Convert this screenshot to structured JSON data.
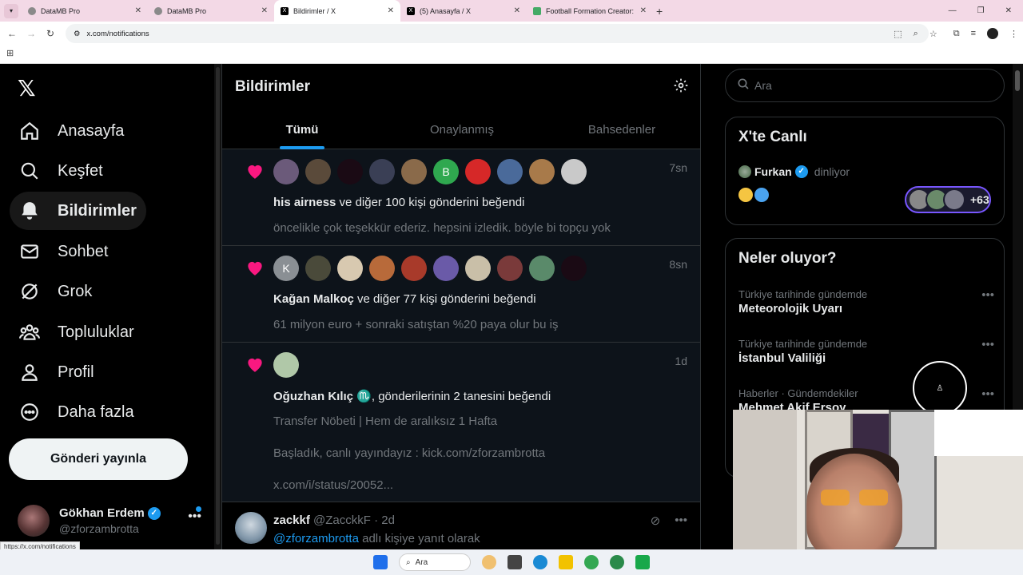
{
  "browser": {
    "tabs": [
      {
        "title": "DataMB Pro",
        "active": false
      },
      {
        "title": "DataMB Pro",
        "active": false
      },
      {
        "title": "Bildirimler / X",
        "active": true
      },
      {
        "title": "(5) Anasayfa / X",
        "active": false
      },
      {
        "title": "Football Formation Creator: Re",
        "active": false
      }
    ],
    "url": "x.com/notifications",
    "status_url": "https://x.com/notifications"
  },
  "nav": {
    "items": [
      {
        "label": "Anasayfa",
        "icon": "home-icon"
      },
      {
        "label": "Keşfet",
        "icon": "search-icon"
      },
      {
        "label": "Bildirimler",
        "icon": "bell-icon",
        "active": true
      },
      {
        "label": "Sohbet",
        "icon": "mail-icon"
      },
      {
        "label": "Grok",
        "icon": "grok-icon"
      },
      {
        "label": "Topluluklar",
        "icon": "communities-icon"
      },
      {
        "label": "Profil",
        "icon": "person-icon"
      },
      {
        "label": "Daha fazla",
        "icon": "more-circle-icon"
      }
    ],
    "post_button": "Gönderi yayınla",
    "profile": {
      "name": "Gökhan Erdem",
      "handle": "@zforzambrotta"
    }
  },
  "main": {
    "title": "Bildirimler",
    "tabs": [
      "Tümü",
      "Onaylanmış",
      "Bahsedenler"
    ],
    "notifications": [
      {
        "time": "7sn",
        "actor": "his airness",
        "action": " ve diğer 100 kişi gönderini beğendi",
        "lines": [
          "öncelikle çok teşekkür ederiz. hepsini izledik. böyle bi topçu yok"
        ],
        "avatars": [
          {
            "letter": "",
            "color": "#6b5a7a"
          },
          {
            "letter": "",
            "color": "#5a4a3a"
          },
          {
            "letter": "",
            "color": "#1a0a14"
          },
          {
            "letter": "",
            "color": "#3a3f55"
          },
          {
            "letter": "",
            "color": "#8a6a4a"
          },
          {
            "letter": "B",
            "color": "#2fa84f"
          },
          {
            "letter": "",
            "color": "#d62828"
          },
          {
            "letter": "",
            "color": "#4a6a9a"
          },
          {
            "letter": "",
            "color": "#a87a4a"
          },
          {
            "letter": "",
            "color": "#c9c9c9"
          }
        ]
      },
      {
        "time": "8sn",
        "actor": "Kağan Malkoç",
        "action": " ve diğer 77 kişi gönderini beğendi",
        "lines": [
          "61 milyon euro + sonraki satıştan %20 paya olur bu iş"
        ],
        "avatars": [
          {
            "letter": "K",
            "color": "#8a8f94"
          },
          {
            "letter": "",
            "color": "#4a4a3a"
          },
          {
            "letter": "",
            "color": "#d8c9b0"
          },
          {
            "letter": "",
            "color": "#b86a3a"
          },
          {
            "letter": "",
            "color": "#a83a2a"
          },
          {
            "letter": "",
            "color": "#6a5aa8"
          },
          {
            "letter": "",
            "color": "#c9bfa8"
          },
          {
            "letter": "",
            "color": "#7a3a3a"
          },
          {
            "letter": "",
            "color": "#5a8a6a"
          },
          {
            "letter": "",
            "color": "#1a0a14"
          }
        ]
      },
      {
        "time": "1d",
        "actor": "Oğuzhan Kılıç ♏",
        "action": ", gönderilerinin 2 tanesini beğendi",
        "lines": [
          "Transfer Nöbeti | Hem de aralıksız 1 Hafta",
          "Başladık, canlı yayındayız : kick.com/zforzambrotta",
          "x.com/i/status/20052..."
        ],
        "avatars": [
          {
            "letter": "",
            "color": "#b0c8a8"
          }
        ]
      }
    ],
    "reply": {
      "name": "zackkf",
      "handle_time": "@ZacckkF · 2d",
      "mention": "@zforzambrotta",
      "suffix": " adlı kişiye yanıt olarak"
    }
  },
  "right": {
    "search_placeholder": "Ara",
    "live": {
      "title": "X'te Canlı",
      "host": "Furkan",
      "status": "dinliyor",
      "listener_count": "+63"
    },
    "trends": {
      "title": "Neler oluyor?",
      "items": [
        {
          "context": "Türkiye tarihinde gündemde",
          "topic": "Meteorolojik Uyarı"
        },
        {
          "context": "Türkiye tarihinde gündemde",
          "topic": "İstanbul Valiliği"
        },
        {
          "context": "Haberler · Gündemdekiler",
          "topic": "Mehmet Akif Ersoy"
        }
      ]
    }
  },
  "taskbar": {
    "search_label": "Ara"
  }
}
